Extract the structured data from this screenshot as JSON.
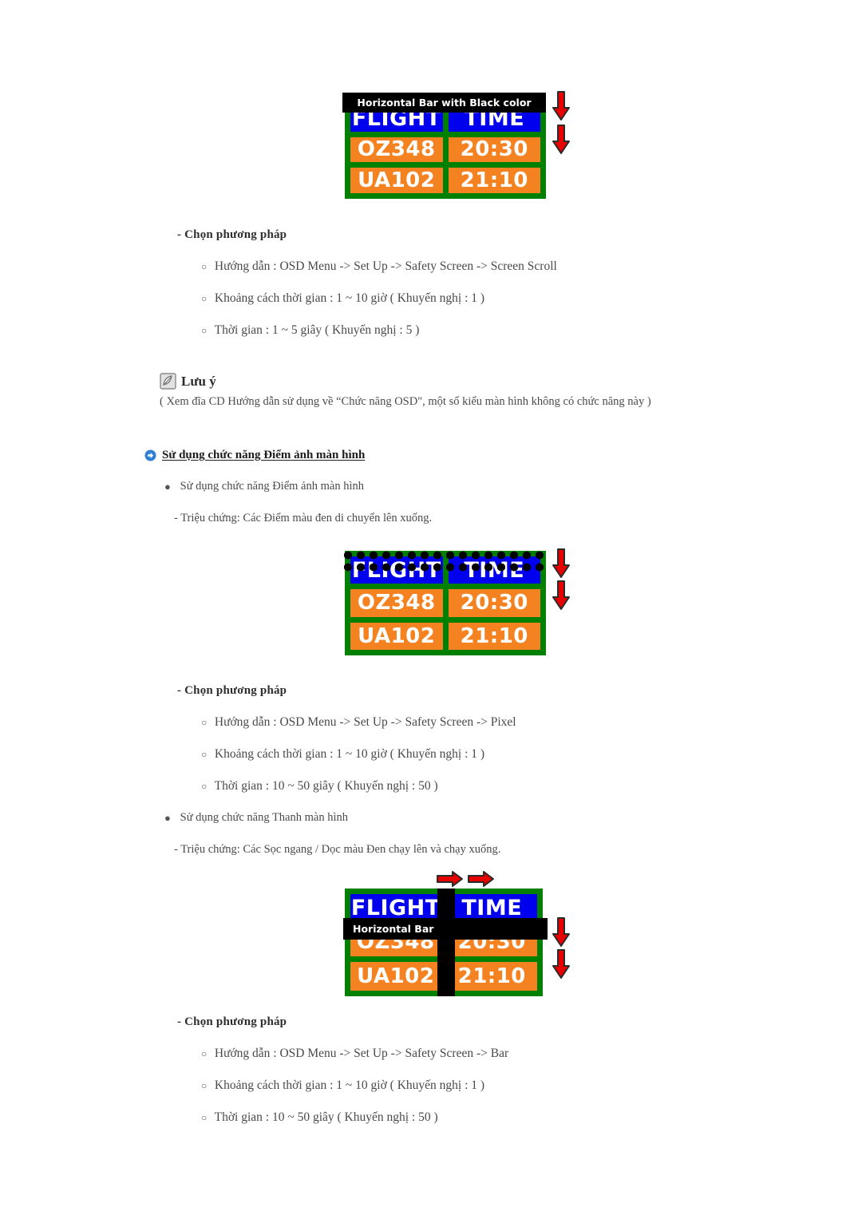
{
  "figures": {
    "board1": {
      "overlay_label": "Horizontal Bar with Black color",
      "headers": [
        "FLIGHT",
        "TIME"
      ],
      "rows": [
        [
          "OZ348",
          "20:30"
        ],
        [
          "UA102",
          "21:10"
        ]
      ],
      "arrows": [
        "down",
        "down"
      ]
    },
    "board2": {
      "headers": [
        "FLIGHT",
        "TIME"
      ],
      "rows": [
        [
          "OZ348",
          "20:30"
        ],
        [
          "UA102",
          "21:10"
        ]
      ],
      "overlay_kind": "pixel-dots",
      "arrows": [
        "down",
        "down"
      ]
    },
    "board3": {
      "overlay_label": "Horizontal Bar",
      "headers": [
        "FLIGHT",
        "TIME"
      ],
      "rows": [
        [
          "OZ348",
          "20:30"
        ],
        [
          "UA102",
          "21:10"
        ]
      ],
      "arrows": [
        "right",
        "right",
        "down",
        "down"
      ]
    }
  },
  "colors": {
    "board_border": "#008000",
    "header_cell": "#0000ee",
    "data_cell": "#f58220",
    "overlay_bar": "#000000",
    "arrow_red": "#e60000",
    "bullet_blue": "#2f7fd6"
  },
  "section1": {
    "method_heading": "- Chọn phương pháp",
    "options": [
      "Hướng dẫn : OSD Menu -> Set Up -> Safety Screen -> Screen Scroll",
      "Khoảng cách thời gian : 1 ~ 10 giờ ( Khuyến nghị : 1 )",
      "Thời gian : 1 ~ 5 giây ( Khuyến nghị : 5 )"
    ]
  },
  "note": {
    "title": "Lưu ý",
    "icon": "note-pencil-icon",
    "body": "( Xem đĩa CD Hướng dẫn sử dụng về “Chức năng OSD\", một số kiểu màn hình không có chức năng này )"
  },
  "pixel_section": {
    "heading": "Sử dụng chức năng Điểm ảnh màn hình",
    "bullet_icon": "blue-arrow-bullet-icon",
    "bullet": "Sử dụng chức năng Điểm ảnh màn hình",
    "symptom": "- Triệu chứng: Các Điểm màu đen di chuyển lên xuống.",
    "method_heading": "- Chọn phương pháp",
    "options": [
      "Hướng dẫn : OSD Menu -> Set Up -> Safety Screen -> Pixel",
      "Khoảng cách thời gian : 1 ~ 10 giờ ( Khuyến nghị : 1 )",
      "Thời gian : 10 ~ 50 giây ( Khuyến nghị : 50 )"
    ]
  },
  "bar_section": {
    "bullet": "Sử dụng chức năng Thanh màn hình",
    "symptom": "- Triệu chứng: Các Sọc ngang / Dọc màu Đen chạy lên và chạy xuống.",
    "method_heading": "- Chọn phương pháp",
    "options": [
      "Hướng dẫn : OSD Menu -> Set Up -> Safety Screen -> Bar",
      "Khoảng cách thời gian : 1 ~ 10 giờ ( Khuyến nghị : 1 )",
      "Thời gian : 10 ~ 50 giây ( Khuyến nghị : 50 )"
    ]
  },
  "glyphs": {
    "open_circle": "○",
    "filled_dot": "●"
  }
}
